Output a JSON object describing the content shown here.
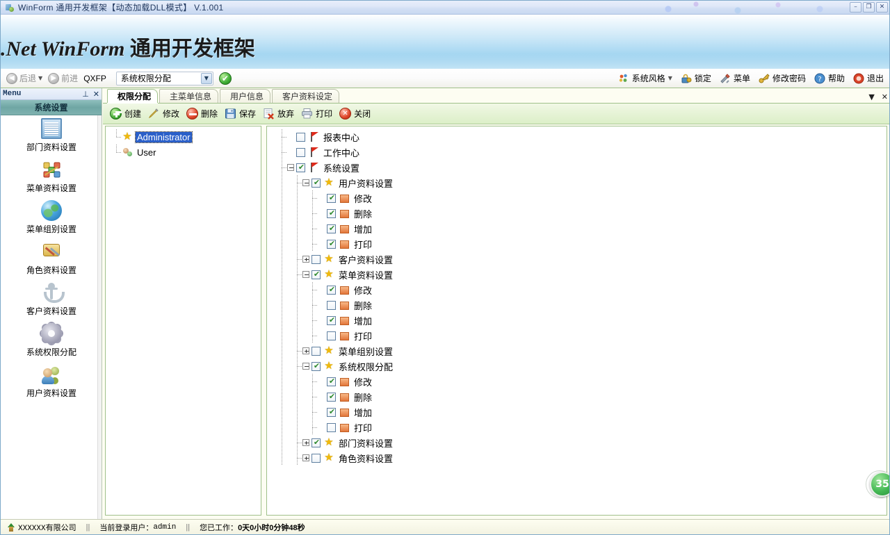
{
  "window": {
    "title": "WinForm 通用开发框架【动态加载DLL模式】 V.1.001",
    "icon": "app-icon",
    "buttons": {
      "minimize": "–",
      "maximize": "❐",
      "close": "✕"
    }
  },
  "banner": {
    "title_en": ".Net WinForm ",
    "title_cn": "通用开发框架"
  },
  "navbar": {
    "back": "后退",
    "forward": "前进",
    "module_code": "QXFP",
    "combo_value": "系统权限分配",
    "combo_arrow": "▼",
    "ok_mark": "✔",
    "right_items": [
      {
        "label": "系统风格",
        "icon": "palette-icon",
        "has_caret": true
      },
      {
        "label": "锁定",
        "icon": "lock-icon",
        "has_caret": false
      },
      {
        "label": "菜单",
        "icon": "tools-icon",
        "has_caret": false
      },
      {
        "label": "修改密码",
        "icon": "key-icon",
        "has_caret": false
      },
      {
        "label": "帮助",
        "icon": "help-icon",
        "has_caret": false
      },
      {
        "label": "退出",
        "icon": "exit-icon",
        "has_caret": false
      }
    ]
  },
  "dock": {
    "header_title": "Menu",
    "pin": "⊥",
    "close": "✕",
    "group_title": "系统设置",
    "items": [
      {
        "label": "部门资料设置",
        "icon": "table-icon"
      },
      {
        "label": "菜单资料设置",
        "icon": "nodes-icon"
      },
      {
        "label": "菜单组别设置",
        "icon": "globe-icon"
      },
      {
        "label": "角色资料设置",
        "icon": "role-icon"
      },
      {
        "label": "客户资料设置",
        "icon": "anchor-icon"
      },
      {
        "label": "系统权限分配",
        "icon": "gear-icon"
      },
      {
        "label": "用户资料设置",
        "icon": "users-icon"
      }
    ]
  },
  "tabs": {
    "items": [
      {
        "label": "权限分配",
        "active": true
      },
      {
        "label": "主菜单信息",
        "active": false
      },
      {
        "label": "用户信息",
        "active": false
      },
      {
        "label": "客户资料设定",
        "active": false
      }
    ],
    "dropdown": "▼",
    "close": "✕"
  },
  "commandbar": {
    "buttons": [
      {
        "label": "创建",
        "icon": "add-icon"
      },
      {
        "label": "修改",
        "icon": "pencil-icon"
      },
      {
        "label": "删除",
        "icon": "delete-icon"
      },
      {
        "label": "保存",
        "icon": "save-icon"
      },
      {
        "label": "放弃",
        "icon": "discard-icon"
      },
      {
        "label": "打印",
        "icon": "print-icon"
      },
      {
        "label": "关闭",
        "icon": "close-icon"
      }
    ]
  },
  "user_tree": {
    "nodes": [
      {
        "label": "Administrator",
        "icon": "star-icon",
        "selected": true
      },
      {
        "label": "User",
        "icon": "user-icon",
        "selected": false
      }
    ]
  },
  "permission_tree": {
    "nodes": [
      {
        "label": "报表中心",
        "level": 0,
        "icon": "flag-icon",
        "checked": false,
        "expander": "none"
      },
      {
        "label": "工作中心",
        "level": 0,
        "icon": "flag-icon",
        "checked": false,
        "expander": "none"
      },
      {
        "label": "系统设置",
        "level": 0,
        "icon": "flag-icon",
        "checked": true,
        "expander": "minus"
      },
      {
        "label": "用户资料设置",
        "level": 1,
        "icon": "star-icon",
        "checked": true,
        "expander": "minus"
      },
      {
        "label": "修改",
        "level": 2,
        "icon": "box-icon",
        "checked": true,
        "expander": "none"
      },
      {
        "label": "删除",
        "level": 2,
        "icon": "box-icon",
        "checked": true,
        "expander": "none"
      },
      {
        "label": "增加",
        "level": 2,
        "icon": "box-icon",
        "checked": true,
        "expander": "none"
      },
      {
        "label": "打印",
        "level": 2,
        "icon": "box-icon",
        "checked": true,
        "expander": "none"
      },
      {
        "label": "客户资料设置",
        "level": 1,
        "icon": "star-icon",
        "checked": false,
        "expander": "plus"
      },
      {
        "label": "菜单资料设置",
        "level": 1,
        "icon": "star-icon",
        "checked": true,
        "expander": "minus"
      },
      {
        "label": "修改",
        "level": 2,
        "icon": "box-icon",
        "checked": true,
        "expander": "none"
      },
      {
        "label": "删除",
        "level": 2,
        "icon": "box-icon",
        "checked": false,
        "expander": "none"
      },
      {
        "label": "增加",
        "level": 2,
        "icon": "box-icon",
        "checked": true,
        "expander": "none"
      },
      {
        "label": "打印",
        "level": 2,
        "icon": "box-icon",
        "checked": false,
        "expander": "none"
      },
      {
        "label": "菜单组别设置",
        "level": 1,
        "icon": "star-icon",
        "checked": false,
        "expander": "plus"
      },
      {
        "label": "系统权限分配",
        "level": 1,
        "icon": "star-icon",
        "checked": true,
        "expander": "minus"
      },
      {
        "label": "修改",
        "level": 2,
        "icon": "box-icon",
        "checked": true,
        "expander": "none"
      },
      {
        "label": "删除",
        "level": 2,
        "icon": "box-icon",
        "checked": true,
        "expander": "none"
      },
      {
        "label": "增加",
        "level": 2,
        "icon": "box-icon",
        "checked": true,
        "expander": "none"
      },
      {
        "label": "打印",
        "level": 2,
        "icon": "box-icon",
        "checked": false,
        "expander": "none"
      },
      {
        "label": "部门资料设置",
        "level": 1,
        "icon": "star-icon",
        "checked": true,
        "expander": "plus"
      },
      {
        "label": "角色资料设置",
        "level": 1,
        "icon": "star-icon",
        "checked": false,
        "expander": "plus"
      }
    ]
  },
  "statusbar": {
    "company": "XXXXXX有限公司",
    "sep1": "||",
    "user_label": "当前登录用户：",
    "user_value": "admin",
    "sep2": "||",
    "worktime_label": "您已工作：",
    "worktime_value": "0天0小时0分钟48秒"
  },
  "badge": {
    "value": "35"
  },
  "colors": {
    "accent_green": "#3fa832",
    "tab_border": "#9fc08a",
    "group_header": "#6fa6a4",
    "selection_blue": "#2a5fc9",
    "banner_blue": "#7cc3ea"
  }
}
